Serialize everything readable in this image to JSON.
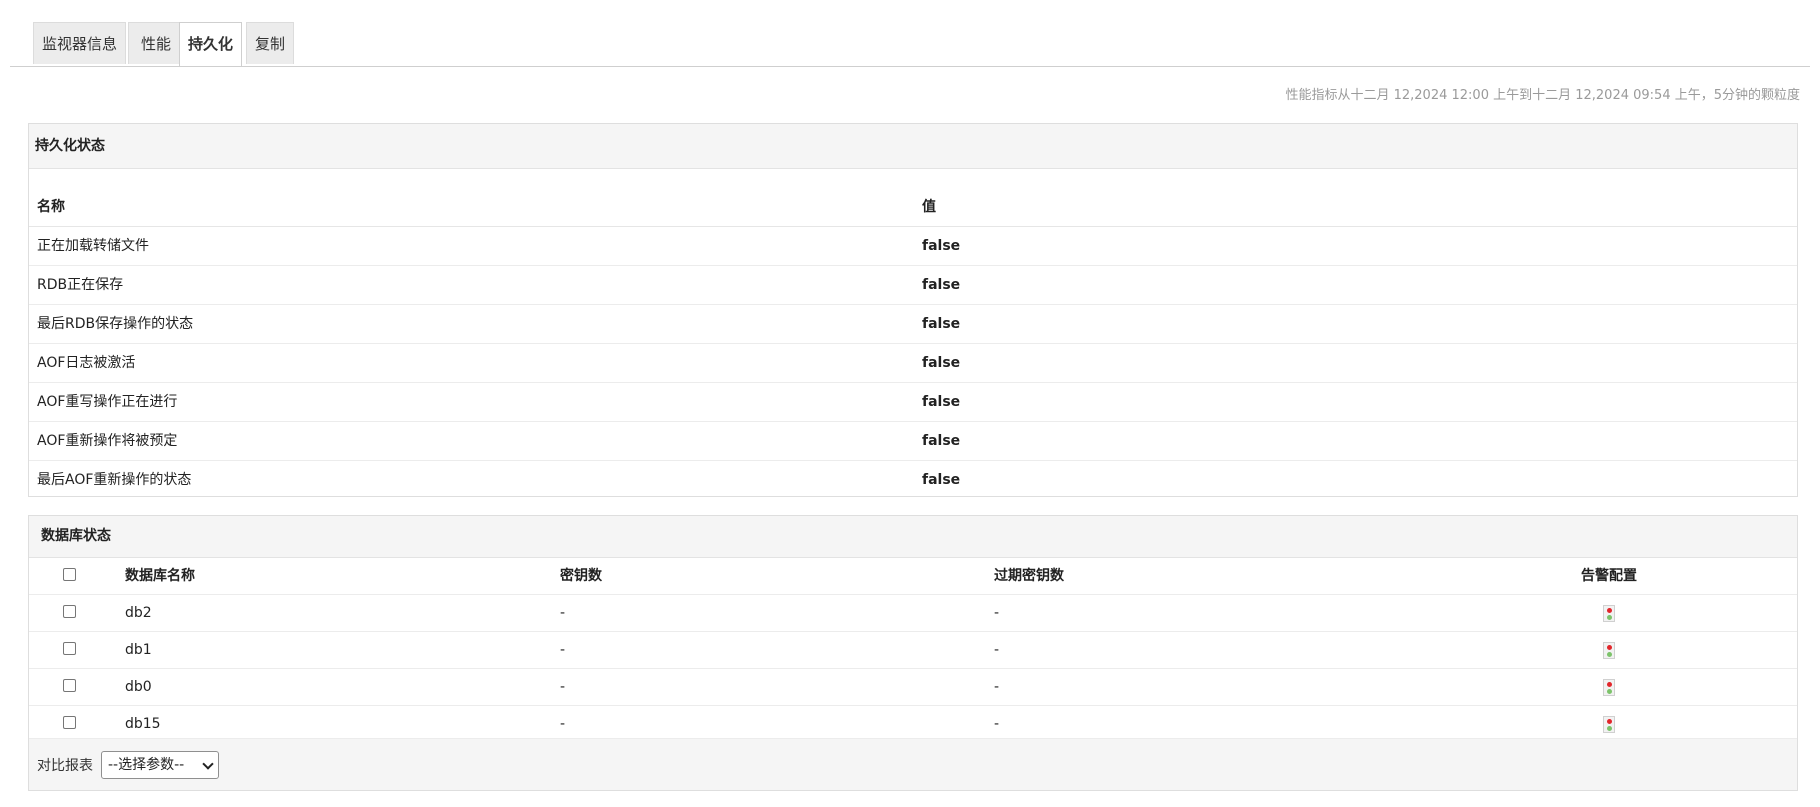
{
  "tabs": [
    {
      "label": "监视器信息",
      "active": false
    },
    {
      "label": "性能",
      "active": false
    },
    {
      "label": "持久化",
      "active": true
    },
    {
      "label": "复制",
      "active": false
    }
  ],
  "perf_note": "性能指标从十二月 12,2024 12:00 上午到十二月 12,2024 09:54 上午，5分钟的颗粒度",
  "persistence": {
    "title": "持久化状态",
    "col_name": "名称",
    "col_value": "值",
    "rows": [
      {
        "name": "正在加载转储文件",
        "value": "false"
      },
      {
        "name": "RDB正在保存",
        "value": "false"
      },
      {
        "name": "最后RDB保存操作的状态",
        "value": "false"
      },
      {
        "name": "AOF日志被激活",
        "value": "false"
      },
      {
        "name": "AOF重写操作正在进行",
        "value": "false"
      },
      {
        "name": "AOF重新操作将被预定",
        "value": "false"
      },
      {
        "name": "最后AOF重新操作的状态",
        "value": "false"
      }
    ]
  },
  "database": {
    "title": "数据库状态",
    "col_name": "数据库名称",
    "col_keys": "密钥数",
    "col_expired": "过期密钥数",
    "col_alarm": "告警配置",
    "rows": [
      {
        "name": "db2",
        "keys": "-",
        "expired": "-",
        "alarm_icon": "traffic-light-icon"
      },
      {
        "name": "db1",
        "keys": "-",
        "expired": "-",
        "alarm_icon": "traffic-light-icon"
      },
      {
        "name": "db0",
        "keys": "-",
        "expired": "-",
        "alarm_icon": "traffic-light-icon"
      },
      {
        "name": "db15",
        "keys": "-",
        "expired": "-",
        "alarm_icon": "traffic-light-icon"
      }
    ],
    "compare_label": "对比报表",
    "compare_select_value": "--选择参数--"
  }
}
